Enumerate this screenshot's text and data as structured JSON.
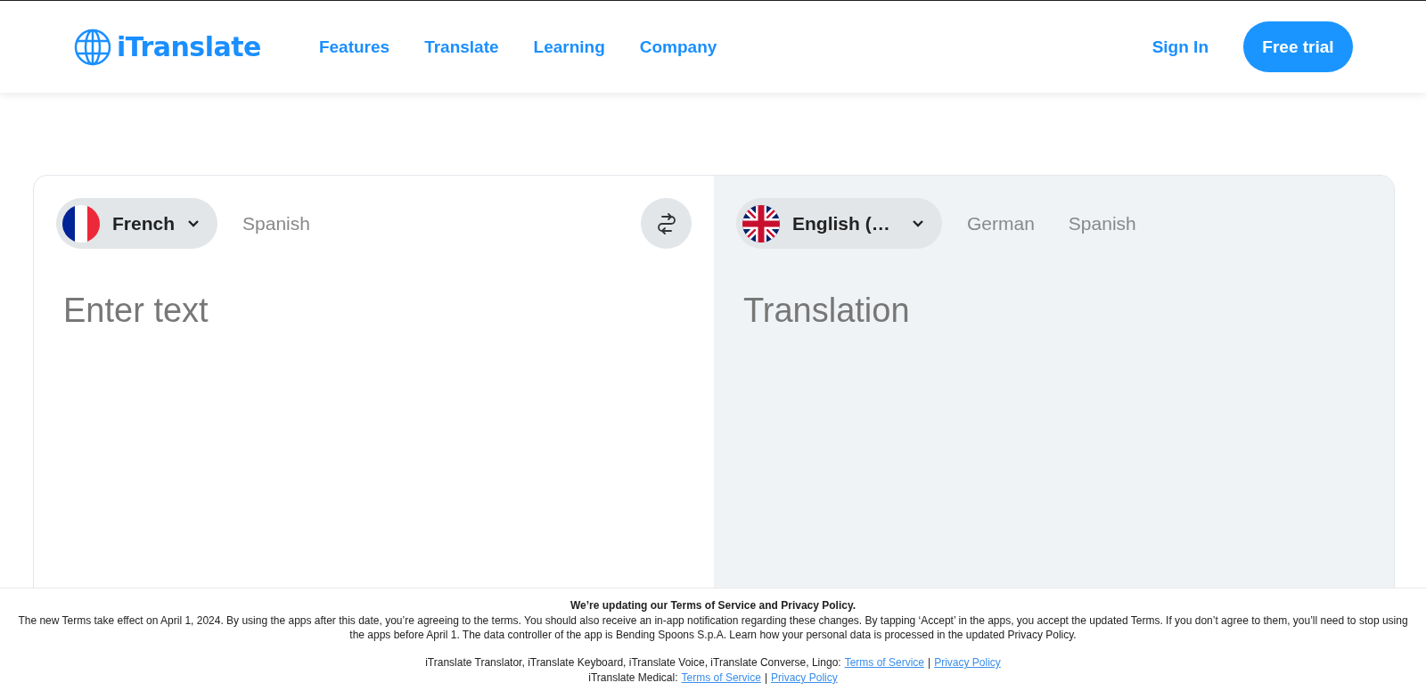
{
  "header": {
    "logo": "iTranslate",
    "nav": [
      "Features",
      "Translate",
      "Learning",
      "Company"
    ],
    "sign_in": "Sign In",
    "cta": "Free trial"
  },
  "source": {
    "language": "French",
    "options": [
      "Spanish"
    ],
    "placeholder": "Enter text"
  },
  "target": {
    "language": "English (…",
    "options": [
      "German",
      "Spanish"
    ],
    "placeholder": "Translation"
  },
  "notice": {
    "title": "We’re updating our Terms of Service and Privacy Policy.",
    "body": "The new Terms take effect on April 1, 2024. By using the apps after this date, you’re agreeing to the terms. You should also receive an in-app notification regarding these changes. By tapping ‘Accept’ in the apps, you accept the updated Terms. If you don’t agree to them, you’ll need to stop using the apps before April 1. The data controller of the app is Bending Spoons S.p.A. Learn how your personal data is processed in the updated Privacy Policy.",
    "lines": [
      {
        "label": "iTranslate Translator, iTranslate Keyboard, iTranslate Voice, iTranslate Converse, Lingo:",
        "links": [
          "Terms of Service",
          "Privacy Policy"
        ],
        "separator": "|"
      },
      {
        "label": "iTranslate Medical:",
        "links": [
          "Terms of Service",
          "Privacy Policy"
        ],
        "separator": "|"
      }
    ]
  }
}
